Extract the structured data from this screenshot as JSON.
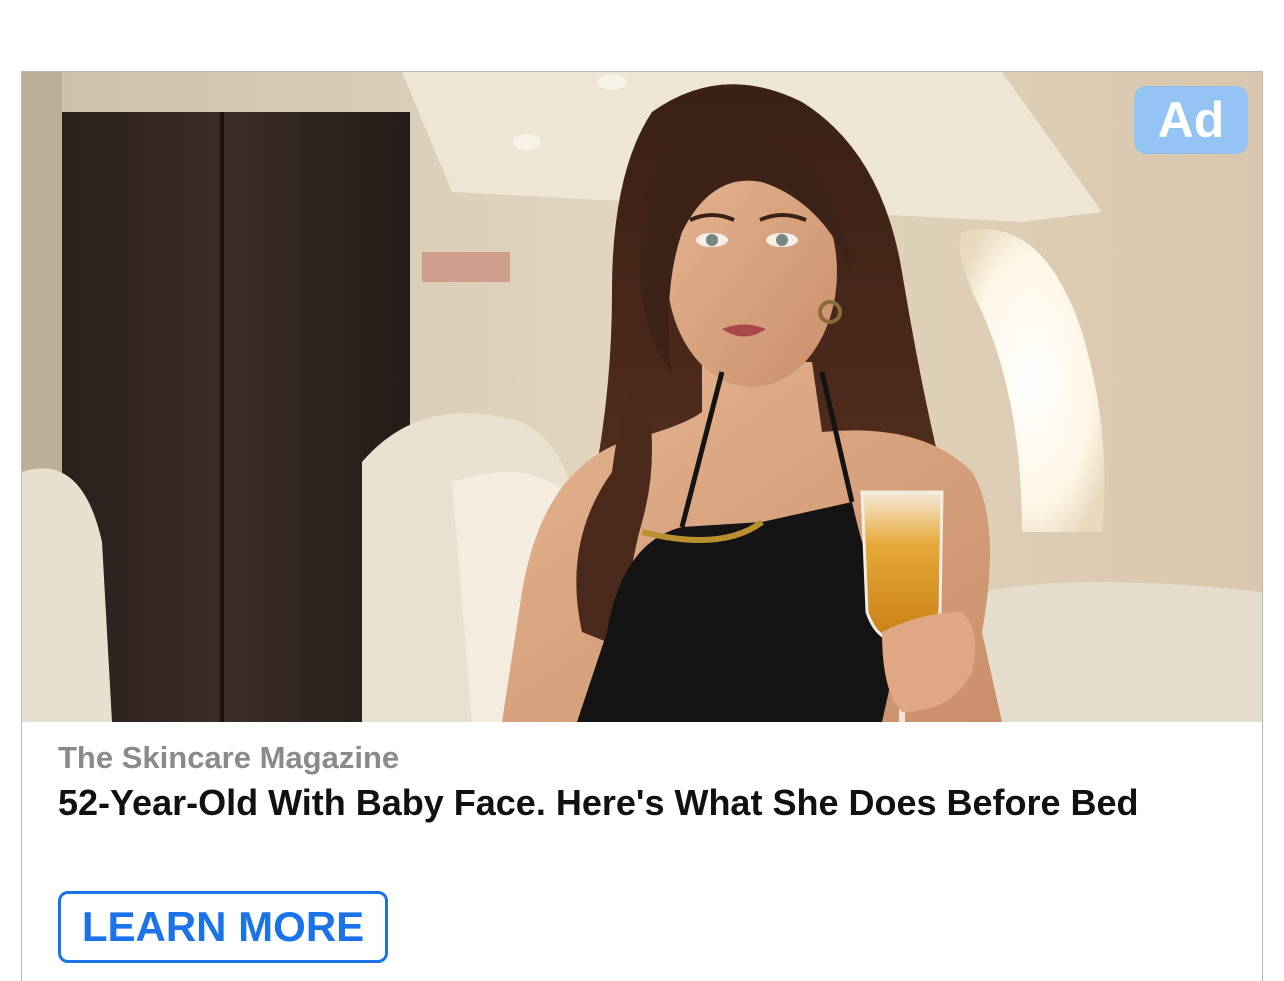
{
  "ad": {
    "badge_label": "Ad",
    "source": "The Skincare Magazine",
    "headline": "52-Year-Old With Baby Face. Here's What She Does Before Bed",
    "cta_label": "LEARN MORE"
  },
  "colors": {
    "badge_bg": "#87c3ff",
    "cta_accent": "#1a73e8",
    "source_text": "#8a8a8a",
    "headline_text": "#111111"
  },
  "image": {
    "subject": "woman-in-black-halter-top-holding-champagne-in-private-jet-cabin"
  }
}
